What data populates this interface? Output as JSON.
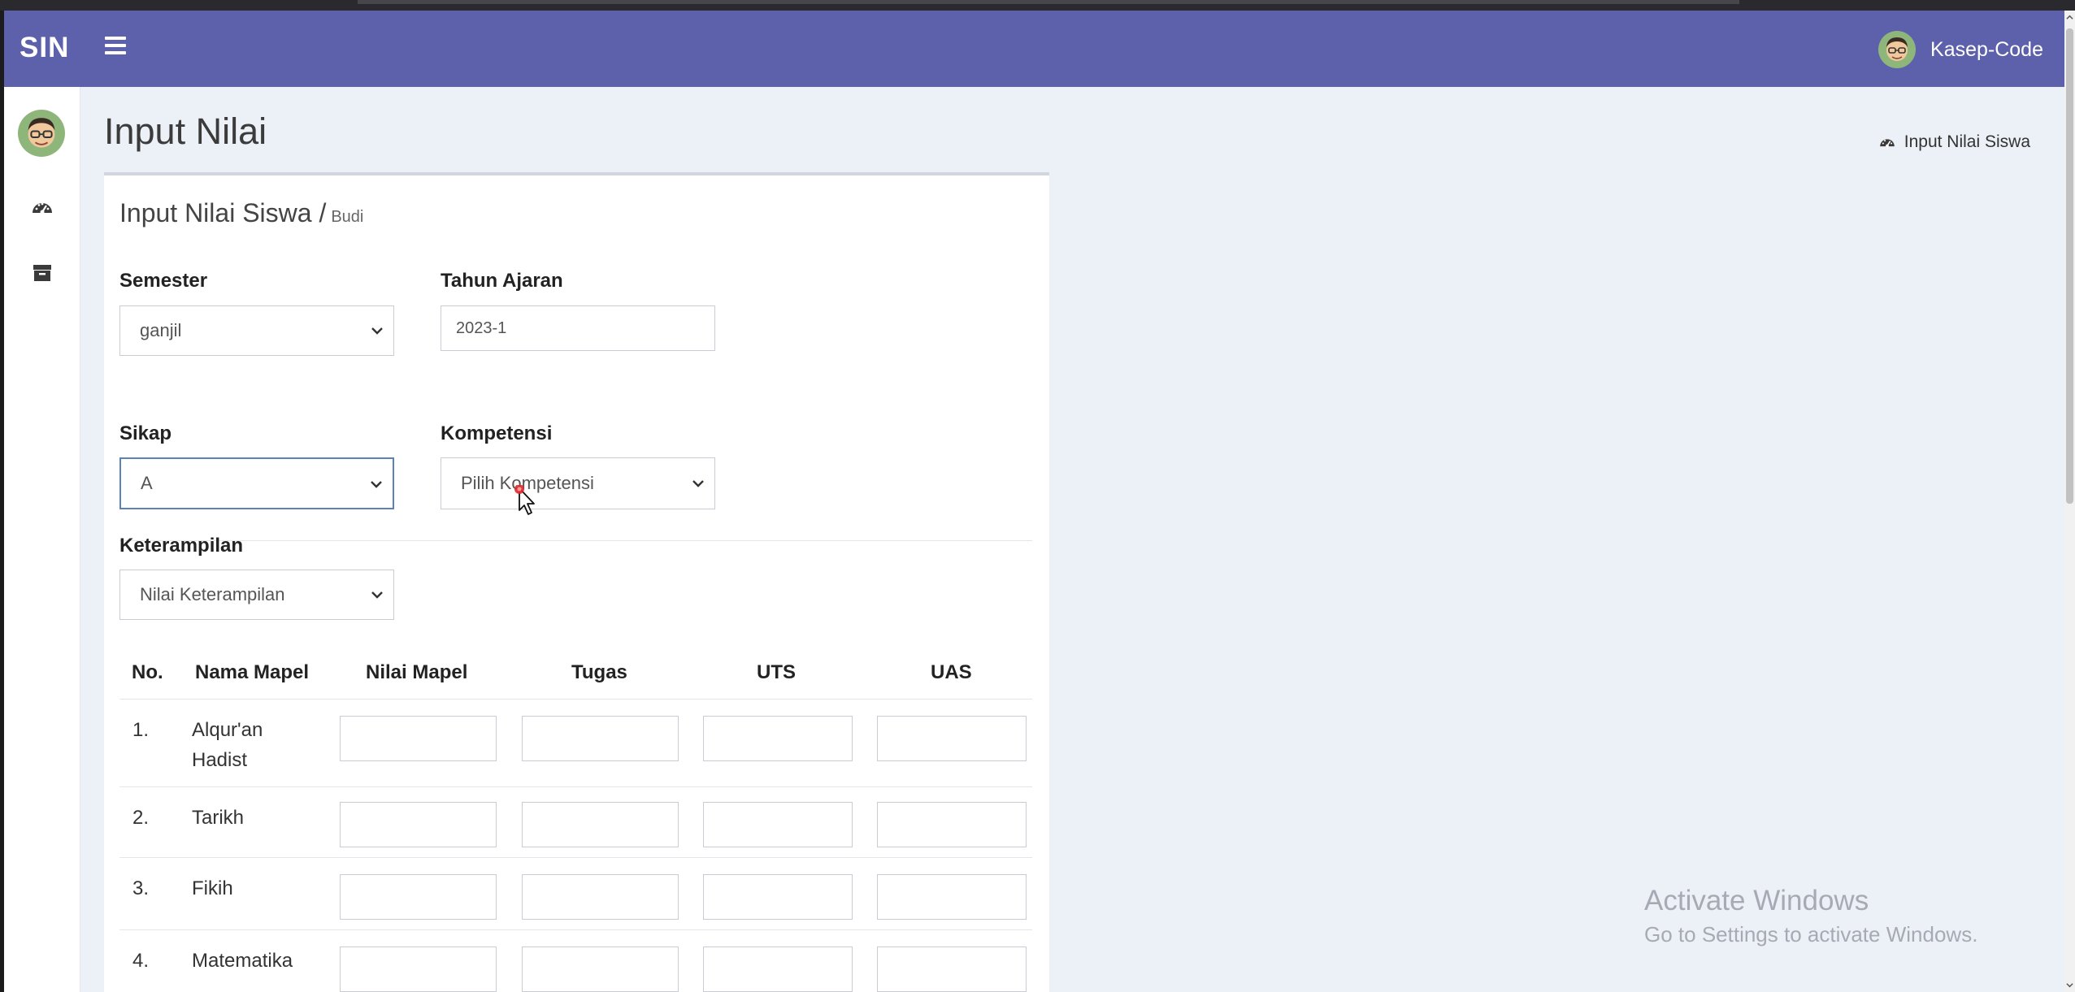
{
  "navbar": {
    "brand": "SIN",
    "user_name": "Kasep-Code"
  },
  "sidebar": {
    "items": [
      {
        "icon": "dashboard-icon"
      },
      {
        "icon": "archive-icon"
      }
    ]
  },
  "header": {
    "page_title": "Input Nilai",
    "breadcrumb": "Input Nilai Siswa"
  },
  "card": {
    "title": "Input Nilai Siswa /",
    "student": "Budi"
  },
  "form": {
    "semester": {
      "label": "Semester",
      "value": "ganjil"
    },
    "tahun_ajaran": {
      "label": "Tahun Ajaran",
      "value": "2023-1"
    },
    "sikap": {
      "label": "Sikap",
      "value": "A"
    },
    "kompetensi": {
      "label": "Kompetensi",
      "value": "Pilih Kompetensi"
    },
    "keterampilan": {
      "label": "Keterampilan",
      "value": "Nilai Keterampilan"
    }
  },
  "table": {
    "headers": [
      "No.",
      "Nama Mapel",
      "Nilai Mapel",
      "Tugas",
      "UTS",
      "UAS"
    ],
    "rows": [
      {
        "no": "1.",
        "mapel_line1": "Alqur'an",
        "mapel_line2": "Hadist"
      },
      {
        "no": "2.",
        "mapel_line1": "Tarikh",
        "mapel_line2": ""
      },
      {
        "no": "3.",
        "mapel_line1": "Fikih",
        "mapel_line2": ""
      },
      {
        "no": "4.",
        "mapel_line1": "Matematika",
        "mapel_line2": ""
      }
    ]
  },
  "watermark": {
    "title": "Activate Windows",
    "subtitle": "Go to Settings to activate Windows."
  },
  "colors": {
    "navbar": "#5d60aa",
    "background": "#ecf0f7",
    "focus_border": "#5a82b8"
  }
}
